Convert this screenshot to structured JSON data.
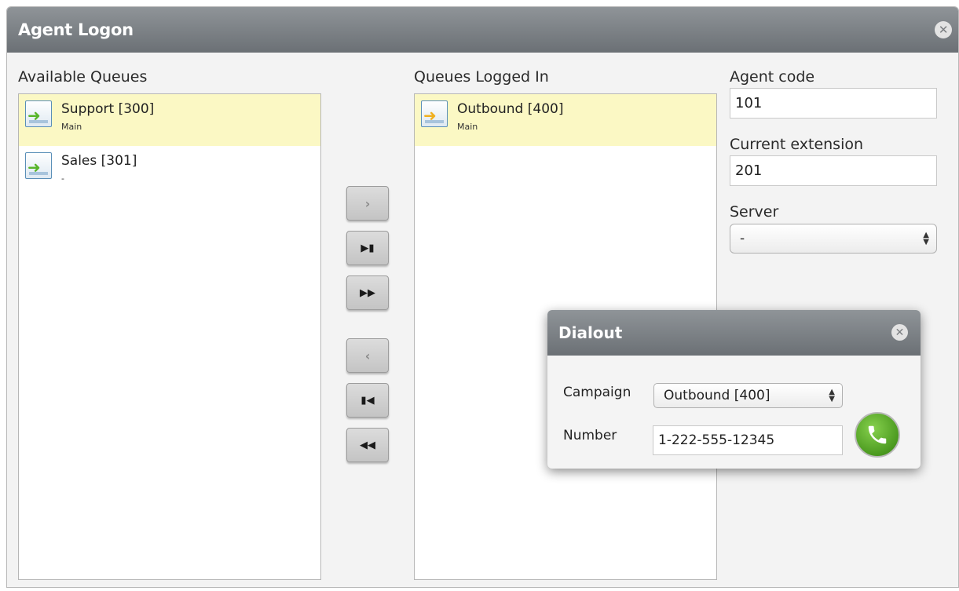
{
  "window": {
    "title": "Agent Logon",
    "close_icon": "close-icon",
    "close_glyph": "✕"
  },
  "available": {
    "label": "Available Queues",
    "items": [
      {
        "name": "Support [300]",
        "sub": "Main",
        "selected": true
      },
      {
        "name": "Sales [301]",
        "sub": "-",
        "selected": false
      }
    ]
  },
  "logged_in": {
    "label": "Queues Logged In",
    "items": [
      {
        "name": "Outbound [400]",
        "sub": "Main",
        "selected": true
      }
    ]
  },
  "nav_buttons": {
    "add": "›",
    "add_last": "▶▮",
    "add_all": "▶▶",
    "remove": "‹",
    "remove_first": "▮◀",
    "remove_all": "◀◀"
  },
  "agent_code": {
    "label": "Agent code",
    "value": "101"
  },
  "current_extension": {
    "label": "Current extension",
    "value": "201"
  },
  "server": {
    "label": "Server",
    "value": "-"
  },
  "dialout": {
    "title": "Dialout",
    "campaign_label": "Campaign",
    "campaign_value": "Outbound [400]",
    "number_label": "Number",
    "number_value": "1-222-555-12345",
    "call_icon": "phone-icon"
  },
  "colors": {
    "title_bar": "#7a7f84",
    "selected_row": "#fbf8c4",
    "call_button": "#58a82a"
  }
}
